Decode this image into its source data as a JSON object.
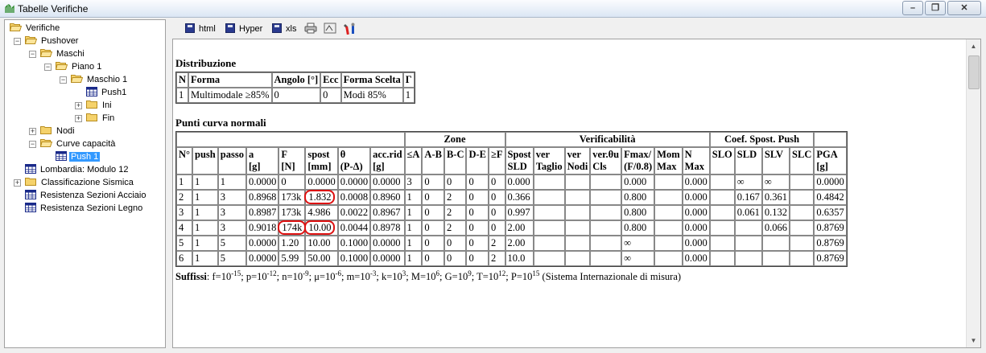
{
  "window": {
    "title": "Tabelle Verifiche"
  },
  "tree": [
    {
      "label": "Verifiche",
      "depth": 0,
      "icon": "folder-open-icon"
    },
    {
      "label": "Pushover",
      "depth": 1,
      "icon": "folder-open-icon"
    },
    {
      "label": "Maschi",
      "depth": 2,
      "icon": "folder-open-icon"
    },
    {
      "label": "Piano 1",
      "depth": 3,
      "icon": "folder-open-icon"
    },
    {
      "label": "Maschio 1",
      "depth": 4,
      "icon": "folder-open-icon"
    },
    {
      "label": "Push1",
      "depth": 5,
      "icon": "table-icon"
    },
    {
      "label": "Ini",
      "depth": 5,
      "icon": "folder-icon"
    },
    {
      "label": "Fin",
      "depth": 5,
      "icon": "folder-icon"
    },
    {
      "label": "Nodi",
      "depth": 2,
      "icon": "folder-icon"
    },
    {
      "label": "Curve capacità",
      "depth": 2,
      "icon": "folder-open-icon"
    },
    {
      "label": "Push 1",
      "depth": 3,
      "icon": "table-icon",
      "selected": true
    },
    {
      "label": "Lombardia: Modulo 12",
      "depth": 1,
      "icon": "table-icon"
    },
    {
      "label": "Classificazione Sismica",
      "depth": 1,
      "icon": "folder-icon"
    },
    {
      "label": "Resistenza Sezioni Acciaio",
      "depth": 1,
      "icon": "table-icon"
    },
    {
      "label": "Resistenza Sezioni Legno",
      "depth": 1,
      "icon": "table-icon"
    }
  ],
  "toolbar": {
    "html": "html",
    "hyper": "Hyper",
    "xls": "xls"
  },
  "distribuzione": {
    "title": "Distribuzione",
    "headers": [
      "N",
      "Forma",
      "Angolo [°]",
      "Ecc",
      "Forma Scelta",
      "Γ"
    ],
    "row": [
      "1",
      "Multimodale ≥85%",
      "0",
      "0",
      "Modi 85%",
      "1"
    ]
  },
  "punti": {
    "title": "Punti curva normali",
    "groups": {
      "zone": "Zone",
      "verif": "Verificabilità",
      "coef": "Coef. Spost. Push"
    },
    "headers": [
      "N°",
      "push",
      "passo",
      "a\n[g]",
      "F\n[N]",
      "spost\n[mm]",
      "θ\n(P-Δ)",
      "acc.rid\n[g]",
      "≤A",
      "A-B",
      "B-C",
      "D-E",
      "≥F",
      "Spost\nSLD",
      "ver\nTaglio",
      "ver\nNodi",
      "ver.θu\nCls",
      "Fmax/\n(F/0.8)",
      "Mom\nMax",
      "N\nMax",
      "SLO",
      "SLD",
      "SLV",
      "SLC",
      "PGA\n[g]"
    ],
    "rows": [
      [
        "1",
        "1",
        "1",
        "0.0000",
        "0",
        "0.0000",
        "0.0000",
        "0.0000",
        "3",
        "0",
        "0",
        "0",
        "0",
        "0.000",
        "",
        "",
        "",
        "0.000",
        "",
        "0.000",
        "",
        "∞",
        "∞",
        "",
        "0.0000"
      ],
      [
        "2",
        "1",
        "3",
        "0.8968",
        "173k",
        "1.832",
        "0.0008",
        "0.8960",
        "1",
        "0",
        "2",
        "0",
        "0",
        "0.366",
        "",
        "",
        "",
        "0.800",
        "",
        "0.000",
        "",
        "0.167",
        "0.361",
        "",
        "0.4842"
      ],
      [
        "3",
        "1",
        "3",
        "0.8987",
        "173k",
        "4.986",
        "0.0022",
        "0.8967",
        "1",
        "0",
        "2",
        "0",
        "0",
        "0.997",
        "",
        "",
        "",
        "0.800",
        "",
        "0.000",
        "",
        "0.061",
        "0.132",
        "",
        "0.6357"
      ],
      [
        "4",
        "1",
        "3",
        "0.9018",
        "174k",
        "10.00",
        "0.0044",
        "0.8978",
        "1",
        "0",
        "2",
        "0",
        "0",
        "2.00",
        "",
        "",
        "",
        "0.800",
        "",
        "0.000",
        "",
        "",
        "0.066",
        "",
        "0.8769"
      ],
      [
        "5",
        "1",
        "5",
        "0.0000",
        "1.20",
        "10.00",
        "0.1000",
        "0.0000",
        "1",
        "0",
        "0",
        "0",
        "2",
        "2.00",
        "",
        "",
        "",
        "∞",
        "",
        "0.000",
        "",
        "",
        "",
        "",
        "0.8769"
      ],
      [
        "6",
        "1",
        "5",
        "0.0000",
        "5.99",
        "50.00",
        "0.1000",
        "0.0000",
        "1",
        "0",
        "0",
        "0",
        "2",
        "10.0",
        "",
        "",
        "",
        "∞",
        "",
        "0.000",
        "",
        "",
        "",
        "",
        "0.8769"
      ]
    ]
  },
  "suffissi": {
    "label": "Suffissi",
    "items": [
      [
        "f",
        "-15"
      ],
      [
        "p",
        "-12"
      ],
      [
        "n",
        "-9"
      ],
      [
        "μ",
        "-6"
      ],
      [
        "m",
        "-3"
      ],
      [
        "k",
        "3"
      ],
      [
        "M",
        "6"
      ],
      [
        "G",
        "9"
      ],
      [
        "T",
        "12"
      ],
      [
        "P",
        "15"
      ]
    ],
    "note": "(Sistema Internazionale di misura)"
  }
}
